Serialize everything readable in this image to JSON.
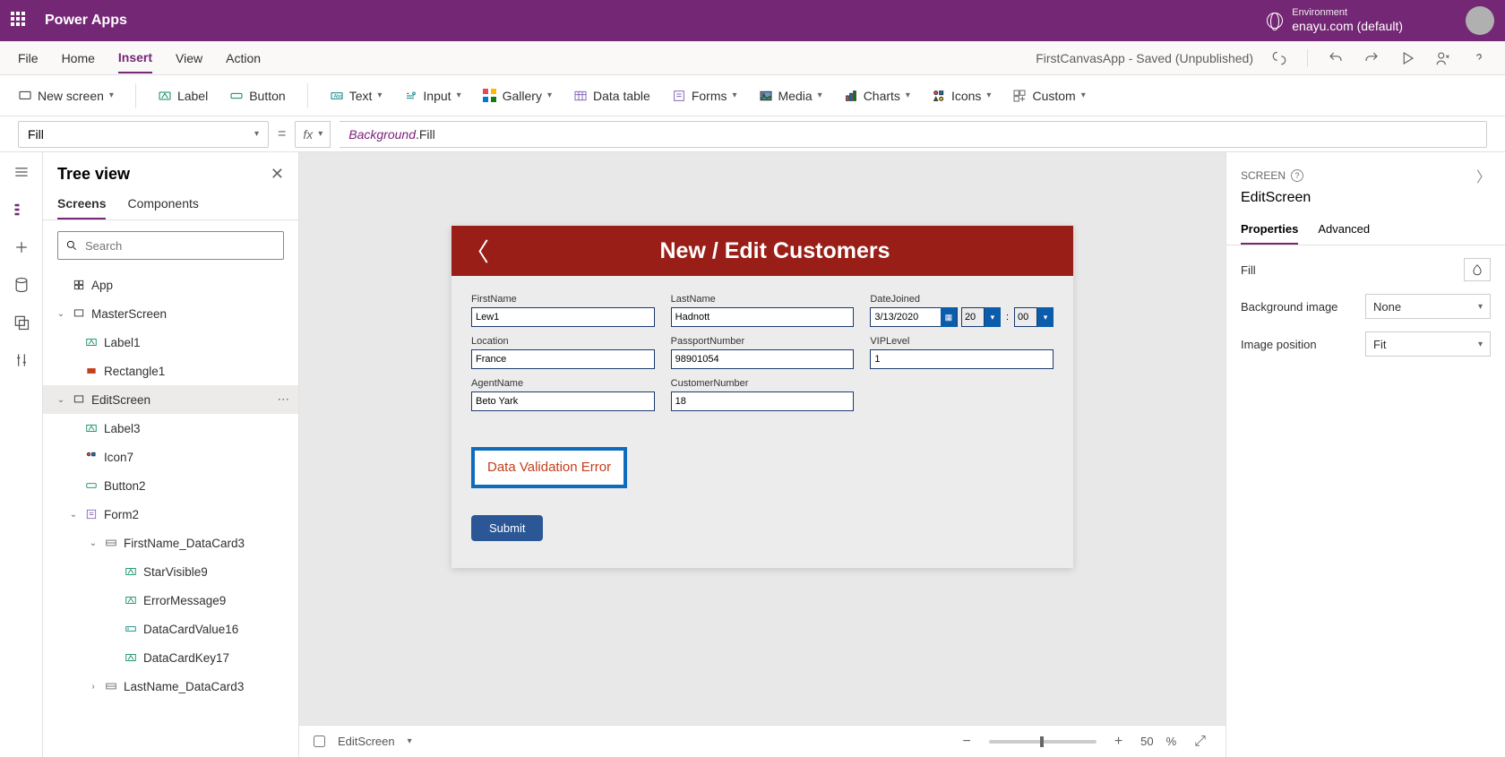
{
  "brand": "Power Apps",
  "environment": {
    "label": "Environment",
    "name": "enayu.com (default)"
  },
  "menubar": [
    "File",
    "Home",
    "Insert",
    "View",
    "Action"
  ],
  "menubar_active": 2,
  "app_status": "FirstCanvasApp - Saved (Unpublished)",
  "ribbon": {
    "new_screen": "New screen",
    "label": "Label",
    "button": "Button",
    "text": "Text",
    "input": "Input",
    "gallery": "Gallery",
    "data_table": "Data table",
    "forms": "Forms",
    "media": "Media",
    "charts": "Charts",
    "icons": "Icons",
    "custom": "Custom"
  },
  "formula": {
    "property": "Fill",
    "fx": "fx",
    "obj": "Background",
    "prop": ".Fill"
  },
  "tree": {
    "title": "Tree view",
    "tabs": [
      "Screens",
      "Components"
    ],
    "tab_active": 0,
    "search_placeholder": "Search",
    "nodes": [
      {
        "label": "App",
        "indent": 0,
        "caret": "",
        "icon": "app"
      },
      {
        "label": "MasterScreen",
        "indent": 0,
        "caret": "▽",
        "icon": "screen"
      },
      {
        "label": "Label1",
        "indent": 1,
        "caret": "",
        "icon": "label"
      },
      {
        "label": "Rectangle1",
        "indent": 1,
        "caret": "",
        "icon": "rect"
      },
      {
        "label": "EditScreen",
        "indent": 0,
        "caret": "▽",
        "icon": "screen",
        "selected": true,
        "dots": true
      },
      {
        "label": "Label3",
        "indent": 1,
        "caret": "",
        "icon": "label"
      },
      {
        "label": "Icon7",
        "indent": 1,
        "caret": "",
        "icon": "iconctl"
      },
      {
        "label": "Button2",
        "indent": 1,
        "caret": "",
        "icon": "button"
      },
      {
        "label": "Form2",
        "indent": 1,
        "caret": "▽",
        "icon": "form"
      },
      {
        "label": "FirstName_DataCard3",
        "indent": 2,
        "caret": "▽",
        "icon": "datacard"
      },
      {
        "label": "StarVisible9",
        "indent": 3,
        "caret": "",
        "icon": "label"
      },
      {
        "label": "ErrorMessage9",
        "indent": 3,
        "caret": "",
        "icon": "label"
      },
      {
        "label": "DataCardValue16",
        "indent": 3,
        "caret": "",
        "icon": "textinput"
      },
      {
        "label": "DataCardKey17",
        "indent": 3,
        "caret": "",
        "icon": "label"
      },
      {
        "label": "LastName_DataCard3",
        "indent": 2,
        "caret": "▹",
        "icon": "datacard"
      }
    ]
  },
  "canvas": {
    "header_title": "New / Edit Customers",
    "fields": {
      "firstname": {
        "label": "FirstName",
        "value": "Lew1"
      },
      "lastname": {
        "label": "LastName",
        "value": "Hadnott"
      },
      "datejoined": {
        "label": "DateJoined",
        "date": "3/13/2020",
        "hh": "20",
        "mm": "00"
      },
      "location": {
        "label": "Location",
        "value": "France"
      },
      "passport": {
        "label": "PassportNumber",
        "value": "98901054"
      },
      "viplevel": {
        "label": "VIPLevel",
        "value": "1"
      },
      "agentname": {
        "label": "AgentName",
        "value": "Beto Yark"
      },
      "custnum": {
        "label": "CustomerNumber",
        "value": "18"
      }
    },
    "error_text": "Data Validation Error",
    "submit": "Submit"
  },
  "canvas_foot": {
    "breadcrumb": "EditScreen",
    "zoom": "50",
    "zoom_unit": "%"
  },
  "props": {
    "screen_label": "SCREEN",
    "name": "EditScreen",
    "tabs": [
      "Properties",
      "Advanced"
    ],
    "tab_active": 0,
    "rows": {
      "fill": "Fill",
      "bgimg": {
        "label": "Background image",
        "value": "None"
      },
      "imgpos": {
        "label": "Image position",
        "value": "Fit"
      }
    }
  }
}
